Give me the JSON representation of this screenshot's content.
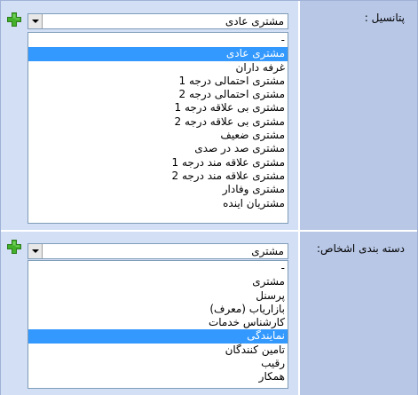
{
  "accent_color": "#3399ff",
  "add_icon": "plus-icon",
  "fields": [
    {
      "label": "پتانسیل :",
      "selected_value": "مشتری عادی",
      "selected_index": 1,
      "options": [
        "-",
        "مشتری عادی",
        "غرفه داران",
        "مشتری احتمالی درجه 1",
        "مشتری احتمالی درجه 2",
        "مشتری بی علاقه درجه 1",
        "مشتری بی علاقه درجه 2",
        "مشتری ضعیف",
        "مشتری صد در صدی",
        "مشتری علاقه مند درجه 1",
        "مشتری علاقه مند درجه 2",
        "مشتری وفادار",
        "مشتریان اینده"
      ]
    },
    {
      "label": "دسته بندی اشخاص:",
      "selected_value": "مشتری",
      "selected_index": 5,
      "options": [
        "-",
        "مشتری",
        "پرسنل",
        "بازاریاب (معرف)",
        "کارشناس خدمات",
        "نمایندگی",
        "تامین کنندگان",
        "رقیب",
        "همکار"
      ]
    }
  ]
}
